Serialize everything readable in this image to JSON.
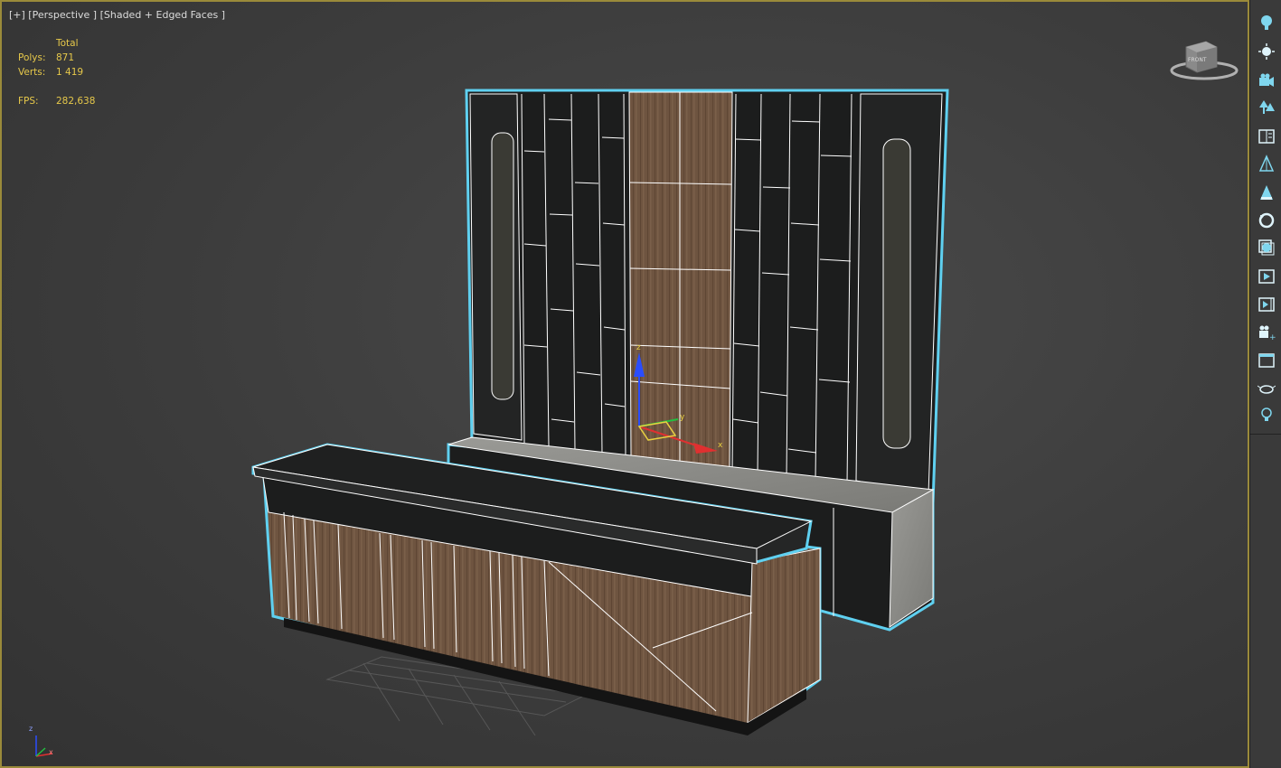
{
  "viewport": {
    "label": "[+] [Perspective ] [Shaded + Edged Faces ]",
    "stats": {
      "header": "Total",
      "polys_label": "Polys:",
      "polys_value": "871",
      "verts_label": "Verts:",
      "verts_value": "1 419",
      "fps_label": "FPS:",
      "fps_value": "282,638"
    },
    "viewcube_label": "FRONT",
    "axis_labels": {
      "x": "x",
      "y": "y",
      "z": "z"
    }
  },
  "toolbar": {
    "items": [
      {
        "name": "light-bulb-icon"
      },
      {
        "name": "sun-icon"
      },
      {
        "name": "camera-icon"
      },
      {
        "name": "tree-icon"
      },
      {
        "name": "library-icon"
      },
      {
        "name": "foliage-icon"
      },
      {
        "name": "object-paint-icon"
      },
      {
        "name": "rotate-icon"
      },
      {
        "name": "material-icon"
      },
      {
        "name": "pivot-icon"
      },
      {
        "name": "render-icon"
      },
      {
        "name": "camera-add-icon"
      },
      {
        "name": "frame-icon"
      },
      {
        "name": "teapot-icon"
      },
      {
        "name": "light-add-icon"
      }
    ]
  },
  "colors": {
    "viewport_border": "#9a8a3a",
    "stats": "#e6c84a",
    "selection": "#5fd0f0",
    "wood": "#6e5440",
    "dark_panel": "#1c1d1d",
    "concrete": "#8c8c88",
    "toolbar_icon": "#7fd6ee"
  }
}
